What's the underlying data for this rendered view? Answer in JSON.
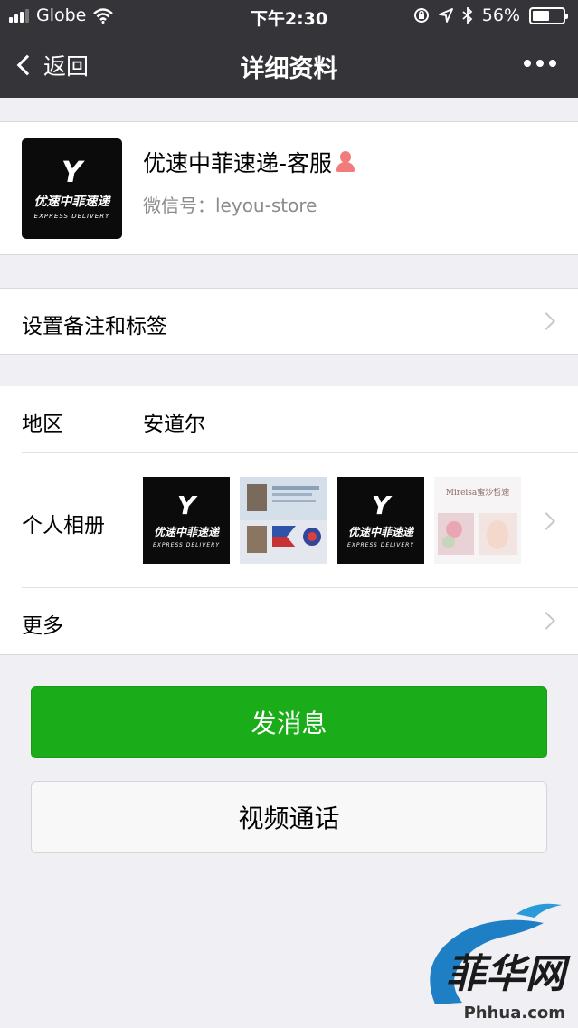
{
  "status_bar": {
    "carrier": "Globe",
    "time": "下午2:30",
    "battery_percent": "56%",
    "battery_level": 0.56
  },
  "nav": {
    "back_label": "返回",
    "title": "详细资料"
  },
  "profile": {
    "name": "优速中菲速递-客服",
    "wechat_id": "微信号：leyou-store",
    "logo_mark": "Y",
    "logo_brand": "优速中菲速递",
    "logo_sub": "EXPRESS DELIVERY"
  },
  "remark": {
    "label": "设置备注和标签"
  },
  "info": {
    "region_label": "地区",
    "region_value": "安道尔",
    "album_label": "个人相册",
    "more_label": "更多"
  },
  "album": {
    "light_caption": "Mireisa蜜沙哲速"
  },
  "buttons": {
    "message": "发消息",
    "video_call": "视频通话"
  },
  "watermark": {
    "text": "菲华网",
    "site": "Phhua.com"
  },
  "colors": {
    "nav_bg": "#353539",
    "primary_green": "#1aad19",
    "page_bg": "#efeff4"
  }
}
